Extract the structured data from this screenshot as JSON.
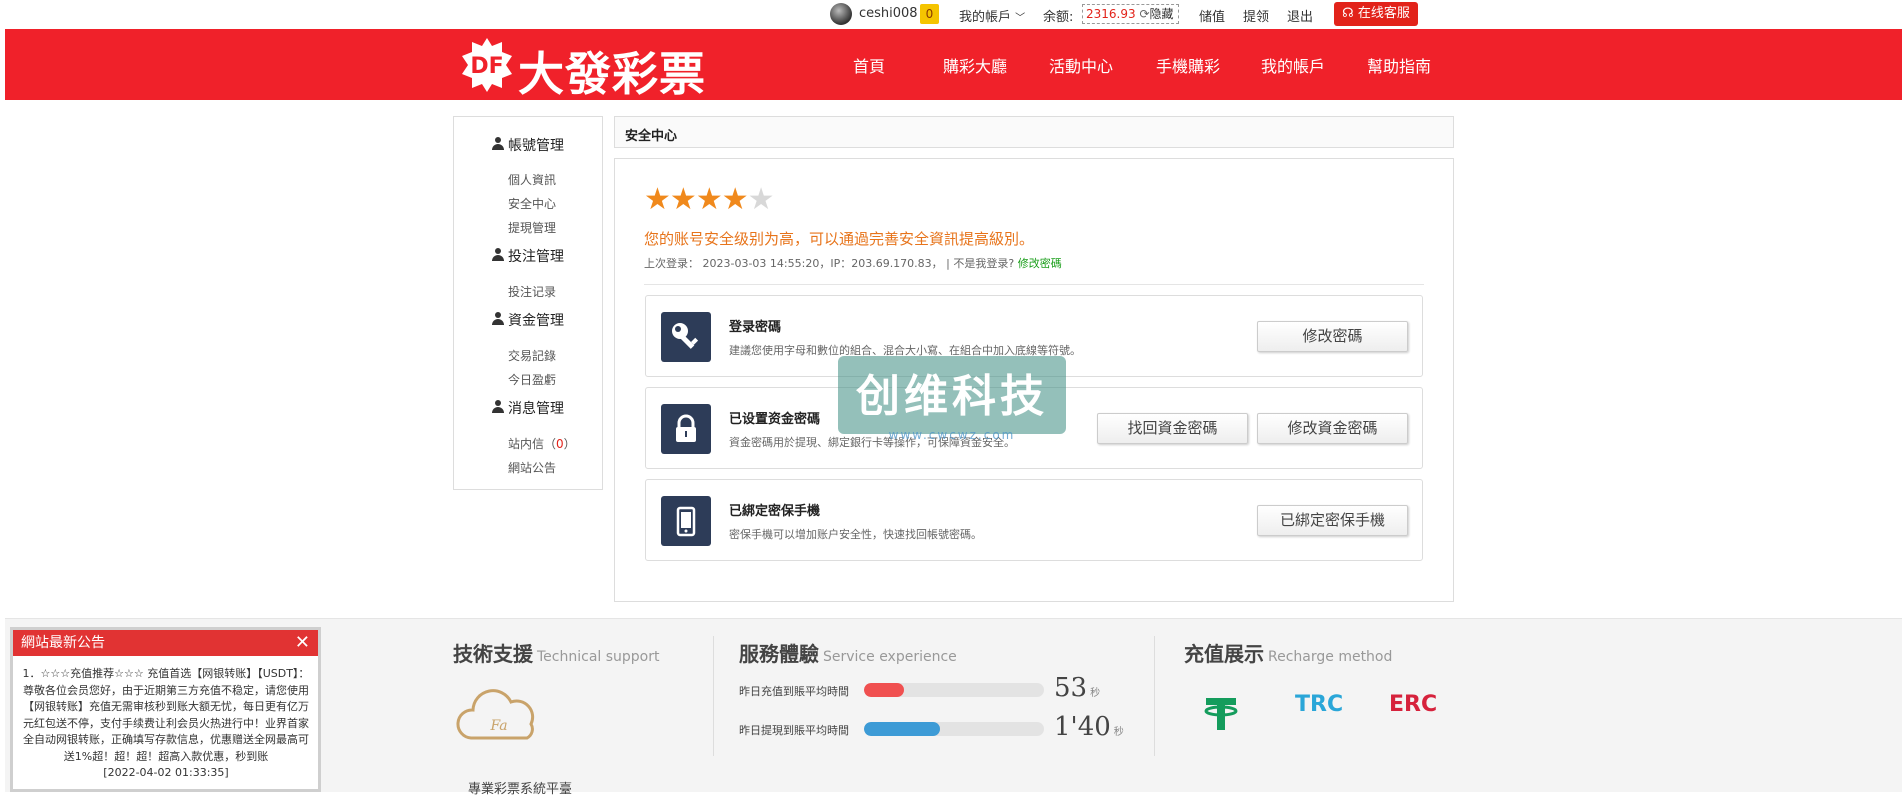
{
  "topbar": {
    "username": "ceshi008",
    "coin_count": "0",
    "my_account": "我的帳戶",
    "balance_label": "余额:",
    "balance_amount": "2316.93",
    "hide_label": "隐藏",
    "deposit": "储值",
    "withdraw": "提领",
    "logout": "退出",
    "service": "在线客服"
  },
  "header": {
    "logo_mark": "DF",
    "logo_text": "大發彩票",
    "nav": [
      "首頁",
      "購彩大廳",
      "活動中心",
      "手機購彩",
      "我的帳戶",
      "幫助指南"
    ]
  },
  "sidebar": {
    "groups": [
      {
        "title": "帳號管理",
        "items": [
          "個人資訊",
          "安全中心",
          "提現管理"
        ]
      },
      {
        "title": "投注管理",
        "items": [
          "投注记录"
        ]
      },
      {
        "title": "資金管理",
        "items": [
          "交易記錄",
          "今日盈虧"
        ]
      },
      {
        "title": "消息管理",
        "items": [
          "站内信",
          "網站公告"
        ]
      }
    ],
    "inbox_count": "0"
  },
  "main": {
    "tab_title": "安全中心",
    "rating": 4,
    "rating_max": 5,
    "level_text": "您的账号安全级别为高，可以通過完善安全資訊提高級別。",
    "last_login": "上次登录： 2023-03-03 14:55:20，IP：203.69.170.83， | 不是我登录?",
    "modify_password_link": "修改密碼",
    "cards": [
      {
        "title": "登录密碼",
        "desc": "建議您使用字母和數位的組合、混合大小寫、在組合中加入底線等符號。",
        "buttons": [
          "修改密碼"
        ],
        "icon": "key-icon"
      },
      {
        "title": "已设置资金密碼",
        "desc": "資金密碼用於提現、綁定銀行卡等操作，可保障資金安全。",
        "buttons": [
          "找回資金密碼",
          "修改資金密碼"
        ],
        "icon": "lock-icon"
      },
      {
        "title": "已綁定密保手機",
        "desc": "密保手機可以增加账户安全性，快速找回帳號密碼。",
        "buttons": [
          "已綁定密保手機"
        ],
        "icon": "phone-icon"
      }
    ]
  },
  "watermark": {
    "text": "创维科技",
    "sub": "www.cwcwz.com"
  },
  "footer": {
    "tech_support": "技術支援",
    "tech_support_en": "Technical support",
    "service_exp": "服務體驗",
    "service_exp_en": "Service experience",
    "recharge": "充值展示",
    "recharge_en": "Recharge method",
    "cloud_label": "Fa",
    "stats": [
      {
        "label": "昨日充值到賬平均時間",
        "value": "53",
        "unit": "秒",
        "fill": 0.22,
        "color": "#f05050"
      },
      {
        "label": "昨日提現到賬平均時間",
        "value": "1'40",
        "unit": "秒",
        "fill": 0.42,
        "color": "#3d9bd6"
      }
    ],
    "pay_methods": [
      "TRC",
      "ERC"
    ],
    "copyright": "專業彩票系統平臺"
  },
  "notice": {
    "title": "網站最新公告",
    "body": "1．☆☆☆充值推荐☆☆☆ 充值首选【网银转账】【USDT】：尊敬各位会员您好，由于近期第三方充值不稳定，请您使用【网银转账】充值无需审核秒到账大额无忧，每日更有亿万元红包送不停，支付手续费让利会员火热进行中！业界首家全自动网银转账，正确填写存款信息，优惠赠送全网最高可送1%超！超！超！超高入款优惠，秒到账",
    "date": "[2022-04-02 01:33:35]"
  },
  "colors": {
    "brand_red": "#f0212a",
    "star": "#f0891c",
    "level_text": "#e7741b",
    "icon_bg": "#2d3c58"
  }
}
